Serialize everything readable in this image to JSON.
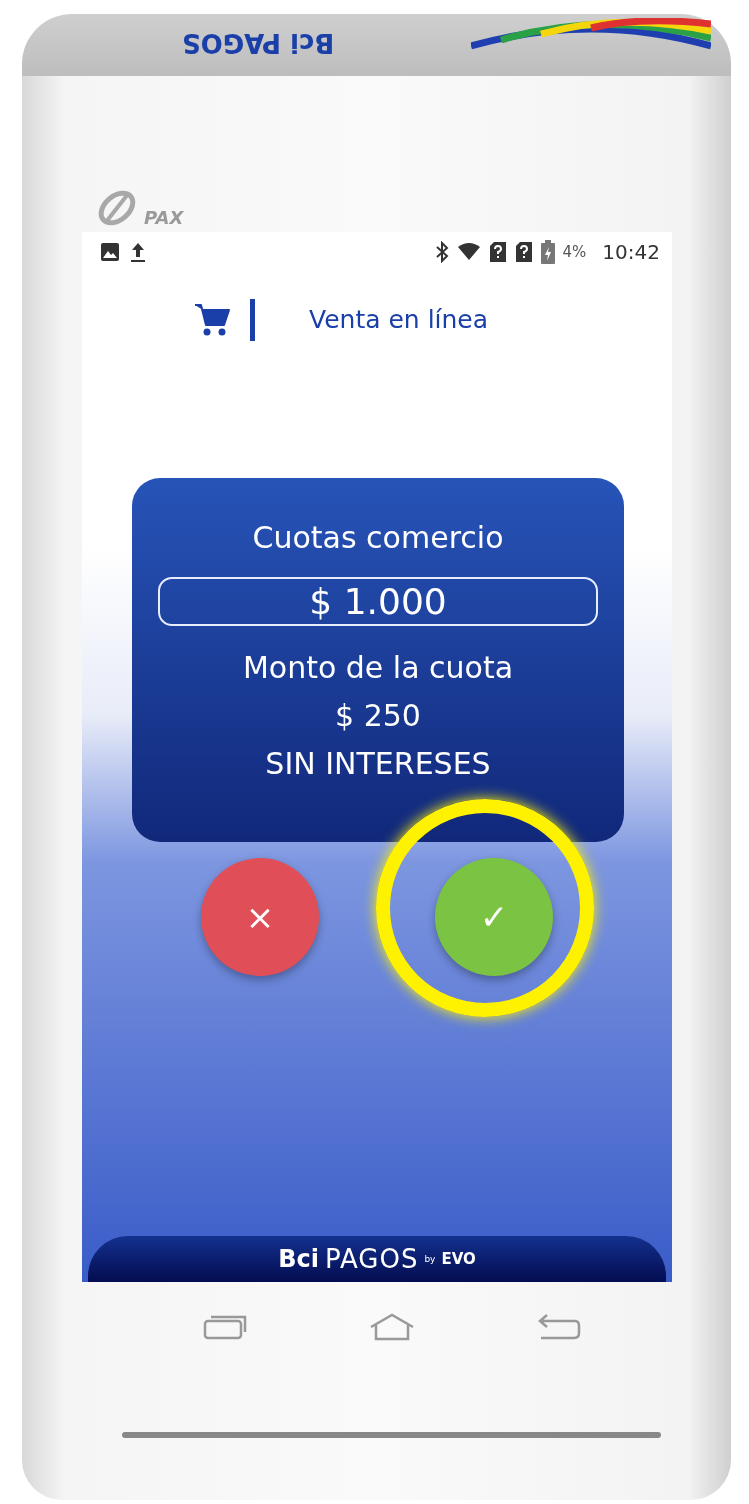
{
  "device": {
    "top_print": "Bci PAGOS",
    "brand": "PAX"
  },
  "status_bar": {
    "battery": "4%",
    "time": "10:42"
  },
  "header": {
    "title": "Venta en línea"
  },
  "card": {
    "title": "Cuotas comercio",
    "amount": "$ 1.000",
    "lines": [
      "Monto de la cuota",
      "$ 250",
      "SIN INTERESES"
    ]
  },
  "actions": [
    {
      "kind": "cancel",
      "label": "×"
    },
    {
      "kind": "confirm",
      "label": "✓",
      "highlighted": true
    }
  ],
  "footer": {
    "brand": "Bci",
    "product": "PAGOS",
    "suffix": "by",
    "partner": "EVO"
  }
}
